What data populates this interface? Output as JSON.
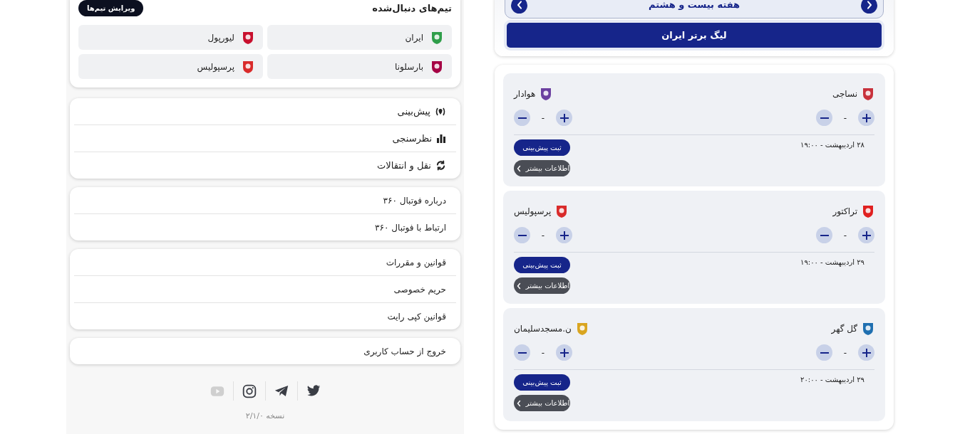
{
  "matches_panel": {
    "week_nav": {
      "title": "هفته بیست و هشتم"
    },
    "league_button": "لیگ برتر ایران",
    "matches": [
      {
        "home": {
          "name": "نساجی",
          "color": "#c8323c"
        },
        "away": {
          "name": "هوادار",
          "color": "#6b3fa0"
        },
        "home_score": "-",
        "away_score": "-",
        "date": "۲۸ اردیبهشت - ۱۹:۰۰",
        "predict_button": "ثبت پیش‌بینی",
        "more_button": "اطلاعات بیشتر"
      },
      {
        "home": {
          "name": "تراکتور",
          "color": "#e02020"
        },
        "away": {
          "name": "پرسپولیس",
          "color": "#d92b2b"
        },
        "home_score": "-",
        "away_score": "-",
        "date": "۲۹ اردیبهشت - ۱۹:۰۰",
        "predict_button": "ثبت پیش‌بینی",
        "more_button": "اطلاعات بیشتر"
      },
      {
        "home": {
          "name": "گل گهر",
          "color": "#1f6fb0"
        },
        "away": {
          "name": "ن.مسجدسلیمان",
          "color": "#d9a520"
        },
        "home_score": "-",
        "away_score": "-",
        "date": "۲۹ اردیبهشت - ۲۰:۰۰",
        "predict_button": "ثبت پیش‌بینی",
        "more_button": "اطلاعات بیشتر"
      }
    ]
  },
  "side_panel": {
    "followed_teams": {
      "title": "تیم‌های دنبال‌شده",
      "edit_button": "ویرایش تیم‌ها",
      "teams": [
        {
          "name": "ایران",
          "color": "#2f9e4a"
        },
        {
          "name": "لیورپول",
          "color": "#c8102e"
        },
        {
          "name": "بارسلونا",
          "color": "#a50044"
        },
        {
          "name": "پرسپولیس",
          "color": "#d92b2b"
        }
      ]
    },
    "menu_groups": [
      [
        {
          "label": "پیش‌بینی",
          "kind": "prediction"
        },
        {
          "label": "نظرسنجی",
          "kind": "poll"
        },
        {
          "label": "نقل و انتقالات",
          "kind": "transfers"
        }
      ],
      [
        {
          "label": "درباره فوتبال ۳۶۰"
        },
        {
          "label": "ارتباط با فوتبال ۳۶۰"
        }
      ],
      [
        {
          "label": "قوانین و مقررات"
        },
        {
          "label": "حریم خصوصی"
        },
        {
          "label": "قوانین کپی رایت"
        }
      ],
      [
        {
          "label": "خروج از حساب کاربری"
        }
      ]
    ],
    "social": [
      {
        "kind": "twitter",
        "disabled": false
      },
      {
        "kind": "telegram",
        "disabled": false
      },
      {
        "kind": "instagram",
        "disabled": false
      },
      {
        "kind": "youtube",
        "disabled": true
      }
    ],
    "version": "نسخه ۲/۱/۰"
  }
}
